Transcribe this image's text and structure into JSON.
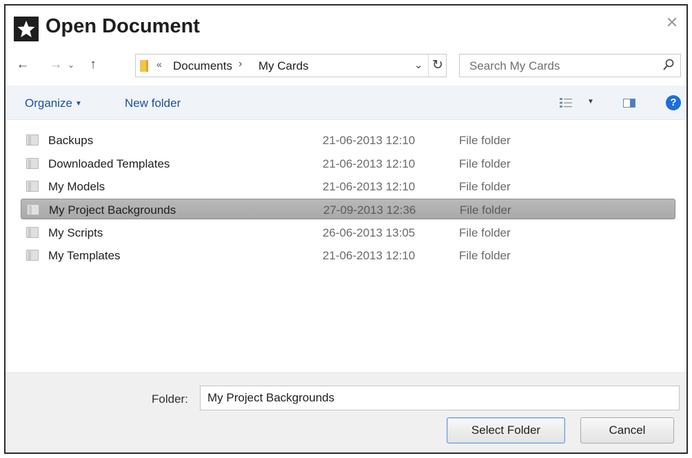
{
  "window": {
    "title": "Open Document",
    "close_glyph": "✕",
    "app_icon": "star-icon"
  },
  "navigation": {
    "back_glyph": "←",
    "forward_glyph": "→",
    "recent_glyph": "⌄",
    "up_glyph": "↑"
  },
  "address_bar": {
    "overflow_glyph": "«",
    "breadcrumbs": [
      "Documents",
      "My Cards"
    ],
    "separator": "›",
    "dropdown_glyph": "⌄",
    "refresh_glyph": "↻"
  },
  "search": {
    "placeholder": "Search My Cards",
    "icon": "search-icon"
  },
  "toolbar": {
    "organize_label": "Organize",
    "organize_caret": "▼",
    "new_folder_label": "New folder",
    "views_icon": "view-list-icon",
    "views_caret": "▼",
    "preview_icon": "preview-pane-icon",
    "help_glyph": "?"
  },
  "files": [
    {
      "name": "Backups",
      "date": "21-06-2013 12:10",
      "type": "File folder"
    },
    {
      "name": "Downloaded Templates",
      "date": "21-06-2013 12:10",
      "type": "File folder"
    },
    {
      "name": "My Models",
      "date": "21-06-2013 12:10",
      "type": "File folder"
    },
    {
      "name": "My Project Backgrounds",
      "date": "27-09-2013 12:36",
      "type": "File folder"
    },
    {
      "name": "My Scripts",
      "date": "26-06-2013 13:05",
      "type": "File folder"
    },
    {
      "name": "My Templates",
      "date": "21-06-2013 12:10",
      "type": "File folder"
    }
  ],
  "selected_file": "My Project Backgrounds",
  "footer": {
    "folder_label": "Folder:",
    "folder_value": "My Project Backgrounds",
    "select_button": "Select Folder",
    "cancel_button": "Cancel"
  },
  "colors": {
    "link_blue": "#1f4e9c",
    "help_blue": "#1c6fd6",
    "selection_gray": "#b0b0b0",
    "folder_yellow": "#f2c54a"
  }
}
